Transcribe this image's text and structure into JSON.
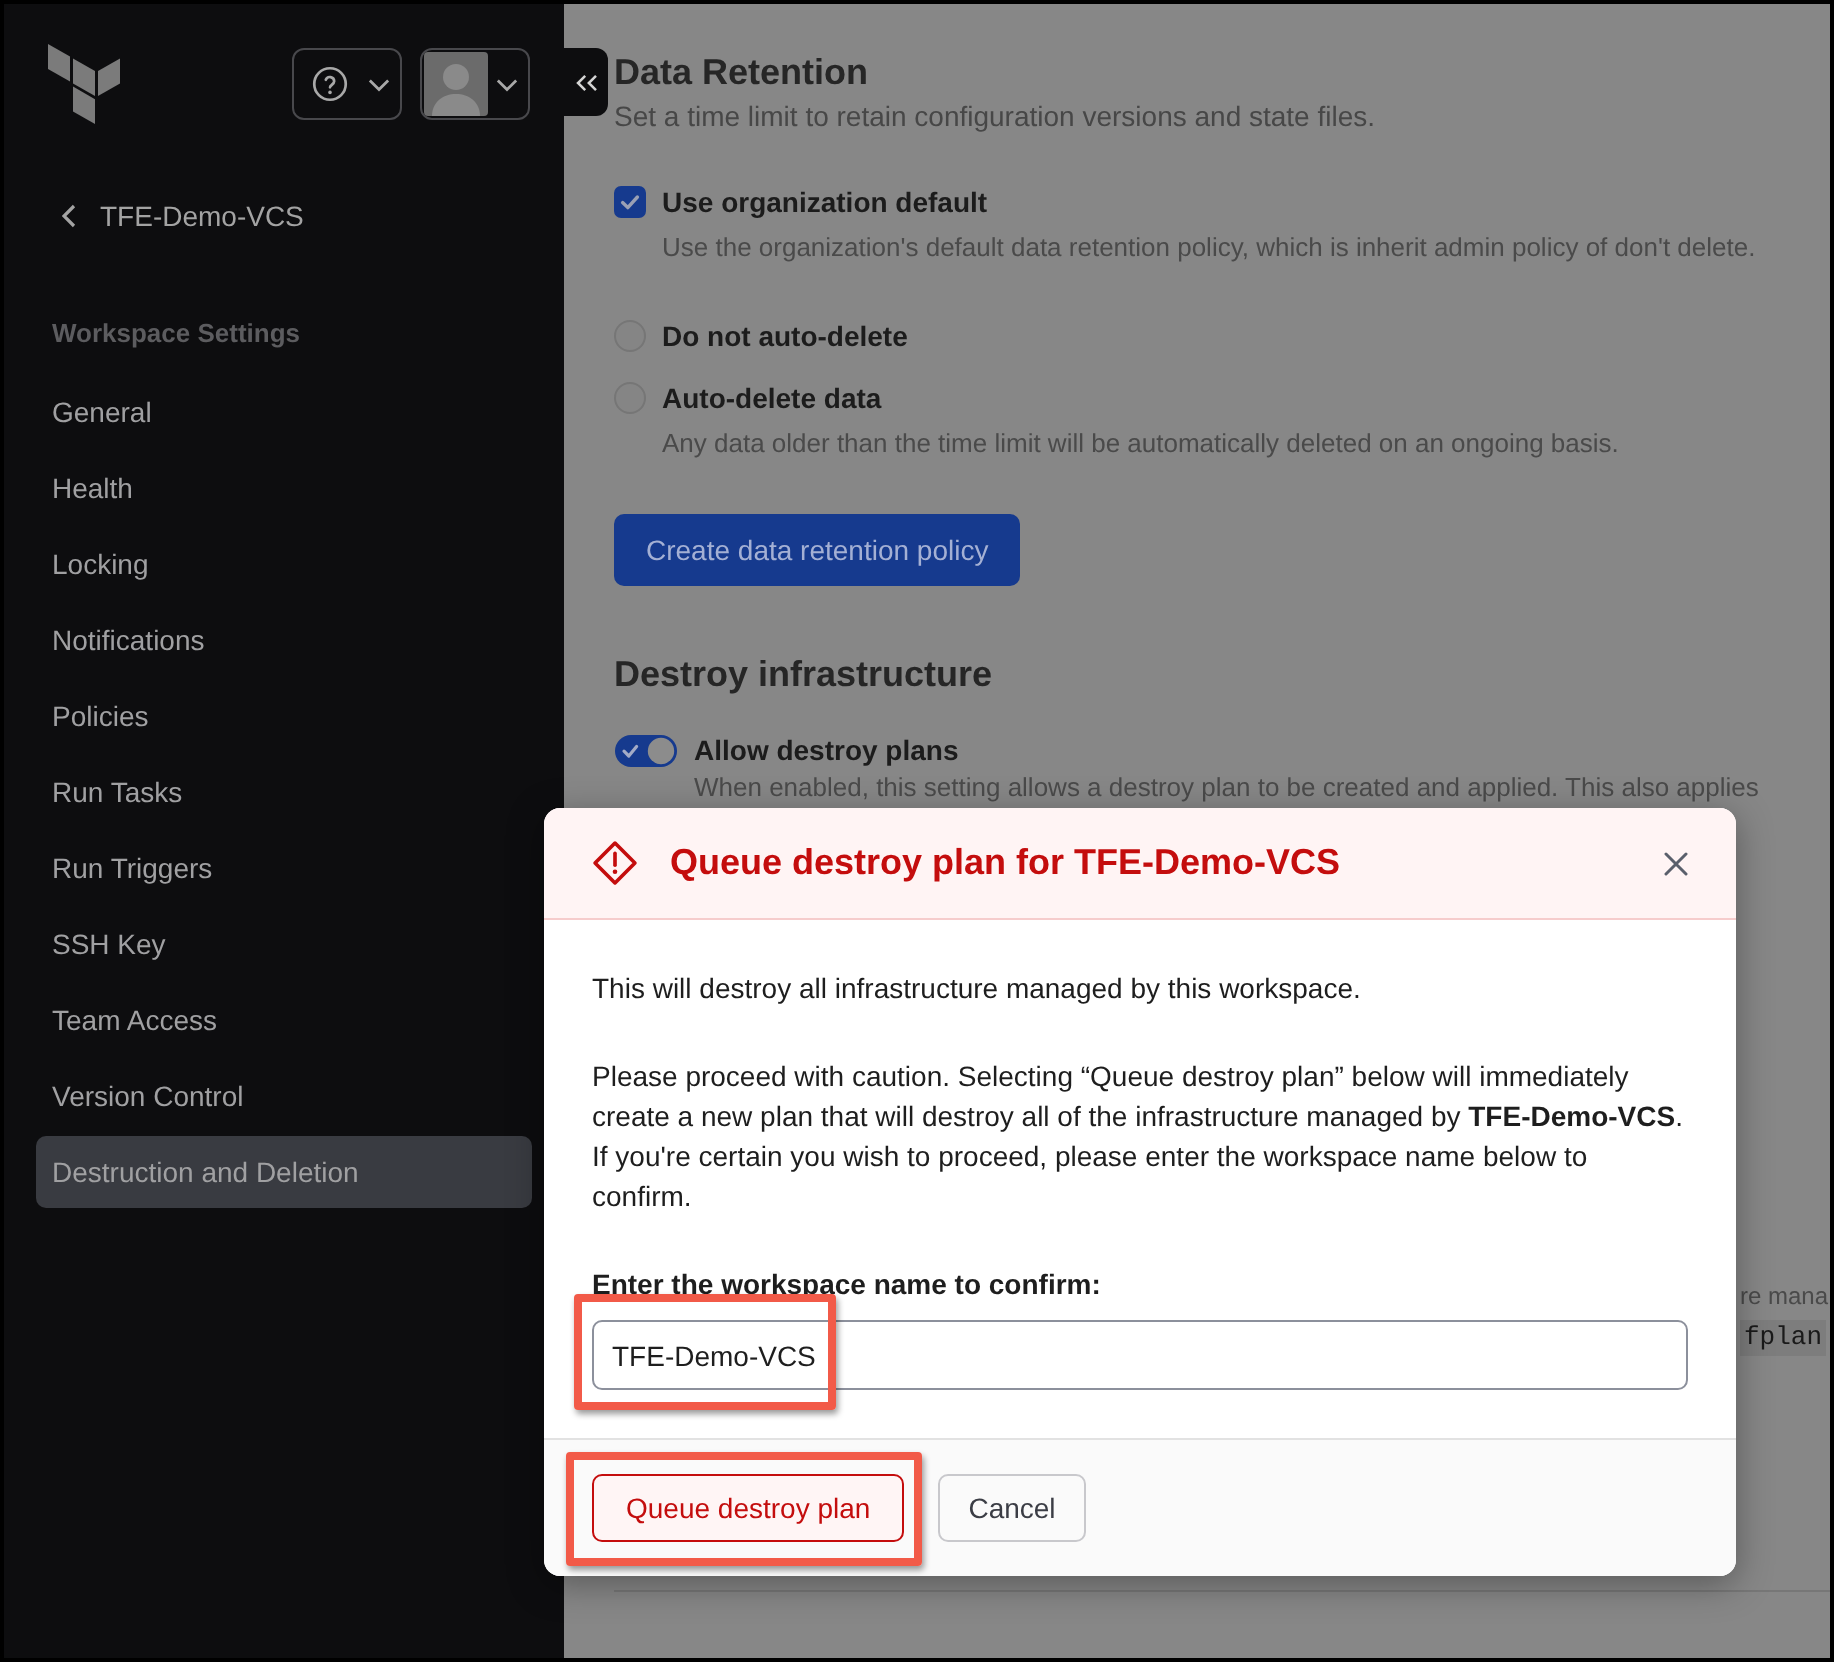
{
  "sidebar": {
    "back_link": "TFE-Demo-VCS",
    "section_title": "Workspace Settings",
    "items": [
      {
        "label": "General",
        "selected": false
      },
      {
        "label": "Health",
        "selected": false
      },
      {
        "label": "Locking",
        "selected": false
      },
      {
        "label": "Notifications",
        "selected": false
      },
      {
        "label": "Policies",
        "selected": false
      },
      {
        "label": "Run Tasks",
        "selected": false
      },
      {
        "label": "Run Triggers",
        "selected": false
      },
      {
        "label": "SSH Key",
        "selected": false
      },
      {
        "label": "Team Access",
        "selected": false
      },
      {
        "label": "Version Control",
        "selected": false
      },
      {
        "label": "Destruction and Deletion",
        "selected": true
      }
    ]
  },
  "main": {
    "data_retention": {
      "title": "Data Retention",
      "subtitle": "Set a time limit to retain configuration versions and state files.",
      "options": [
        {
          "kind": "checkbox",
          "label": "Use organization default",
          "description": "Use the organization's default data retention policy, which is inherit admin policy of don't delete.",
          "checked": true
        },
        {
          "kind": "radio",
          "label": "Do not auto-delete",
          "selected": false
        },
        {
          "kind": "radio",
          "label": "Auto-delete data",
          "description": "Any data older than the time limit will be automatically deleted on an ongoing basis.",
          "selected": false
        }
      ],
      "button": "Create data retention policy"
    },
    "destroy_infrastructure": {
      "title": "Destroy infrastructure",
      "toggle": {
        "label": "Allow destroy plans",
        "on": true
      },
      "description": "When enabled, this setting allows a destroy plan to be created and applied. This also applies"
    },
    "partly_hidden": [
      {
        "kind": "text",
        "text": "re mana"
      },
      {
        "kind": "code",
        "text": "fplan"
      }
    ]
  },
  "modal": {
    "title": "Queue destroy plan for TFE-Demo-VCS",
    "intro": "This will destroy all infrastructure managed by this workspace.",
    "warning": "Please proceed with caution. Selecting “Queue destroy plan” below will immediately create a new plan that will destroy all of the infrastructure managed by **TFE-Demo-VCS**. If you're certain you wish to proceed, please enter the workspace name below to confirm.",
    "field": {
      "label": "Enter the workspace name to confirm:",
      "value": "TFE-Demo-VCS",
      "highlighted": true
    },
    "buttons": [
      {
        "label": "Queue destroy plan",
        "kind": "danger",
        "highlighted": true
      },
      {
        "label": "Cancel",
        "kind": "secondary",
        "highlighted": false
      }
    ]
  }
}
